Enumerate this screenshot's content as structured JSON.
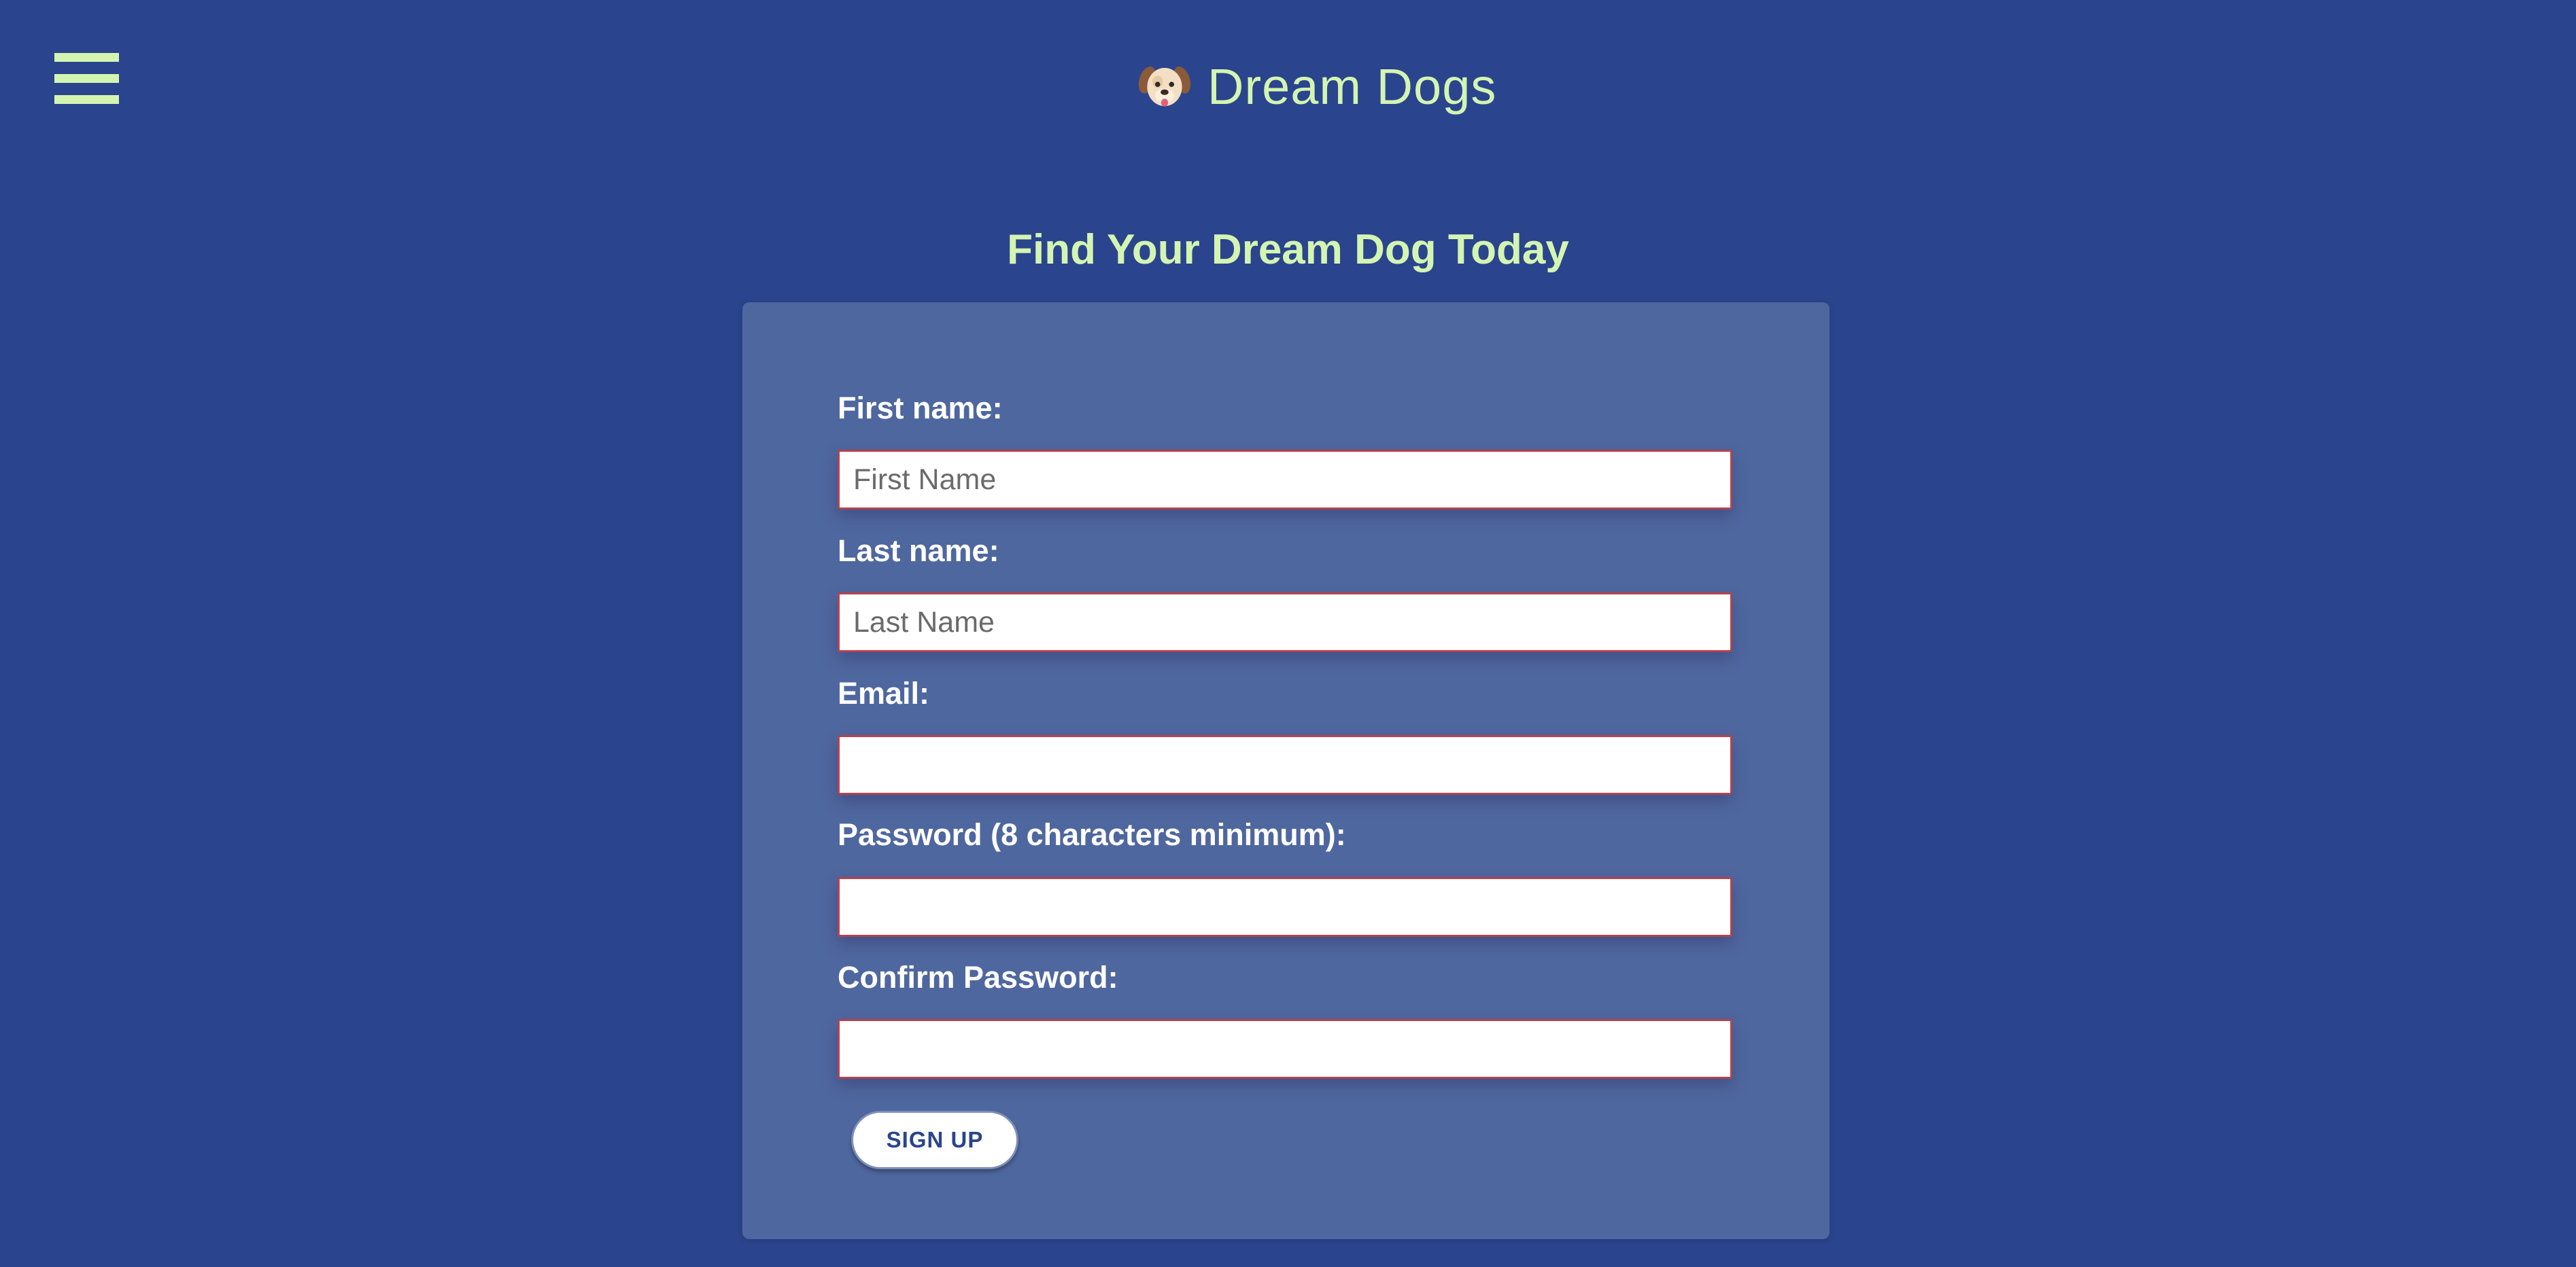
{
  "header": {
    "brand_name": "Dream Dogs",
    "logo_icon": "dog-face-icon",
    "menu_icon": "hamburger-menu-icon"
  },
  "main": {
    "title": "Find Your Dream Dog Today"
  },
  "form": {
    "fields": [
      {
        "label": "First name:",
        "placeholder": "First Name",
        "value": ""
      },
      {
        "label": "Last name:",
        "placeholder": "Last Name",
        "value": ""
      },
      {
        "label": "Email:",
        "placeholder": "",
        "value": ""
      },
      {
        "label": "Password (8 characters minimum):",
        "placeholder": "",
        "value": ""
      },
      {
        "label": "Confirm Password:",
        "placeholder": "",
        "value": ""
      }
    ],
    "submit_label": "SIGN UP"
  },
  "colors": {
    "background": "#2a448d",
    "card": "#4f679f",
    "accent": "#d4f5b2",
    "input_border": "#b4424e",
    "button_text": "#2a448d"
  }
}
